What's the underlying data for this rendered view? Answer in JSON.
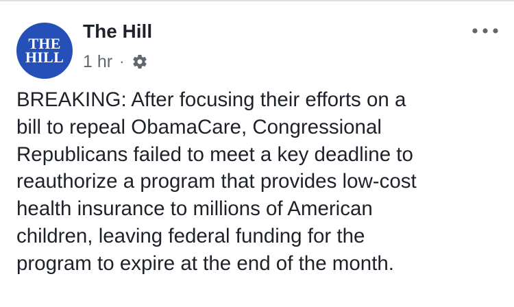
{
  "post": {
    "author": {
      "name": "The Hill",
      "logo_line1": "THE",
      "logo_line2": "HILL",
      "logo_color": "#2450b8"
    },
    "meta": {
      "timestamp": "1 hr",
      "separator": "·",
      "audience_icon": "gear-icon"
    },
    "more_icon": "more-options-icon",
    "text": "BREAKING: After focusing their efforts on a\nbill to repeal ObamaCare, Congressional\nRepublicans failed to meet a key deadline to\nreauthorize a program that provides low-cost\nhealth insurance to millions of American\nchildren, leaving federal funding for the\nprogram to expire at the end of the month."
  }
}
